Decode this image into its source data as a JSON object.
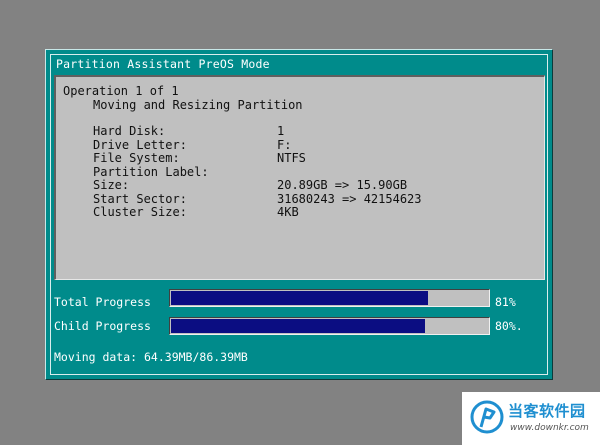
{
  "window": {
    "title": "Partition Assistant PreOS Mode"
  },
  "operation": {
    "header": "Operation 1 of 1",
    "description": "Moving and Resizing Partition",
    "details": [
      {
        "label": "Hard Disk:",
        "value": "1"
      },
      {
        "label": "Drive Letter:",
        "value": "F:"
      },
      {
        "label": "File System:",
        "value": "NTFS"
      },
      {
        "label": "Partition Label:",
        "value": ""
      },
      {
        "label": "Size:",
        "value": "20.89GB => 15.90GB"
      },
      {
        "label": "Start Sector:",
        "value": "31680243 => 42154623"
      },
      {
        "label": "Cluster Size:",
        "value": "4KB"
      }
    ]
  },
  "progress": {
    "total": {
      "label": "Total Progress",
      "percent_text": "81%",
      "fraction": 0.81
    },
    "child": {
      "label": "Child Progress",
      "percent_text": "80%.",
      "fraction": 0.8
    }
  },
  "status": {
    "text": "Moving data: 64.39MB/86.39MB"
  },
  "colors": {
    "window_bg": "#008b8b",
    "panel_bg": "#c0c0c0",
    "progress_fill": "#0b0d82",
    "desktop_bg": "#828282"
  },
  "watermark": {
    "text": "当客软件园",
    "url": "www.downkr.com"
  }
}
